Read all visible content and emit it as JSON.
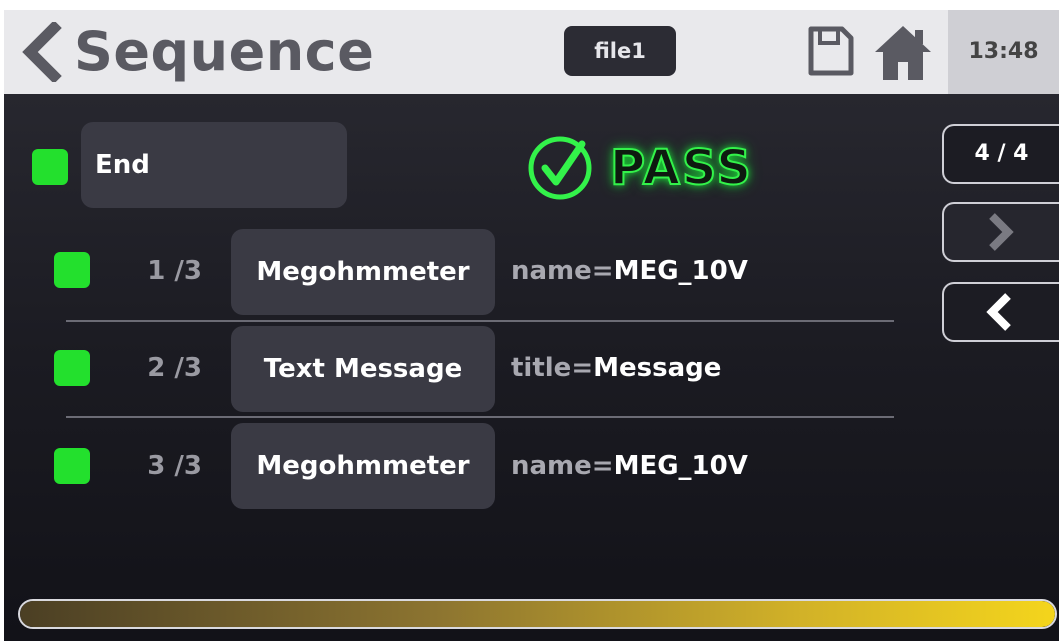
{
  "header": {
    "title": "Sequence",
    "file_name": "file1",
    "time": "13:48"
  },
  "status": {
    "end_label": "End",
    "result": "PASS"
  },
  "pager": {
    "page_indicator": "4 / 4"
  },
  "steps": [
    {
      "index": "1 /3",
      "type": "Megohmmeter",
      "param_key": "name=",
      "param_value": "MEG_10V"
    },
    {
      "index": "2 /3",
      "type": "Text Message",
      "param_key": "title=",
      "param_value": "Message"
    },
    {
      "index": "3 /3",
      "type": "Megohmmeter",
      "param_key": "name=",
      "param_value": "MEG_10V"
    }
  ],
  "progress": {
    "fraction": 1.0
  },
  "colors": {
    "status_green": "#23e02d",
    "pass_green": "#33f24a",
    "progress_gold": "#f4d51c"
  },
  "icons": [
    "back-arrow-icon",
    "save-icon",
    "home-icon",
    "check-circle-icon",
    "chevron-right-icon",
    "chevron-left-icon"
  ]
}
